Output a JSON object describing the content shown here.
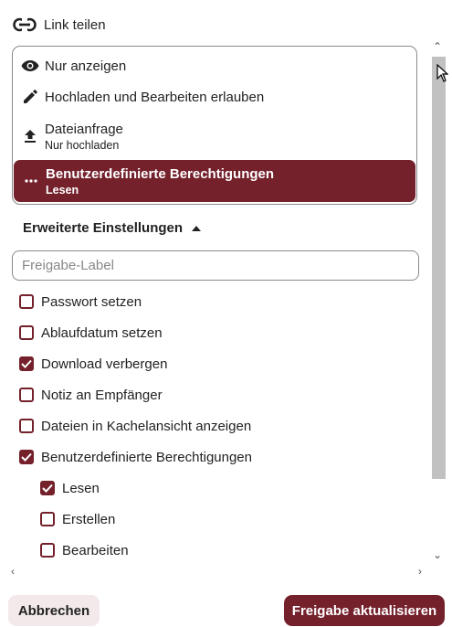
{
  "header": {
    "title": "Link teilen",
    "icon": "link-icon"
  },
  "permissions": [
    {
      "label": "Nur anzeigen",
      "sub": "",
      "icon": "eye-icon"
    },
    {
      "label": "Hochladen und Bearbeiten erlauben",
      "sub": "",
      "icon": "pencil-icon"
    },
    {
      "label": "Dateianfrage",
      "sub": "Nur hochladen",
      "icon": "upload-icon"
    },
    {
      "label": "Benutzerdefinierte Berechtigungen",
      "sub": "Lesen",
      "icon": "more-icon",
      "selected": true
    }
  ],
  "advanced": {
    "title": "Erweiterte Einstellungen",
    "label_placeholder": "Freigabe-Label",
    "options": [
      {
        "label": "Passwort setzen",
        "checked": false
      },
      {
        "label": "Ablaufdatum setzen",
        "checked": false
      },
      {
        "label": "Download verbergen",
        "checked": true
      },
      {
        "label": "Notiz an Empfänger",
        "checked": false
      },
      {
        "label": "Dateien in Kachelansicht anzeigen",
        "checked": false
      },
      {
        "label": "Benutzerdefinierte Berechtigungen",
        "checked": true
      }
    ],
    "custom_permissions": [
      {
        "label": "Lesen",
        "checked": true
      },
      {
        "label": "Erstellen",
        "checked": false
      },
      {
        "label": "Bearbeiten",
        "checked": false
      }
    ]
  },
  "footer": {
    "cancel_label": "Abbrechen",
    "submit_label": "Freigabe aktualisieren"
  },
  "colors": {
    "accent": "#74212c",
    "light_accent": "#f3e9ea"
  }
}
